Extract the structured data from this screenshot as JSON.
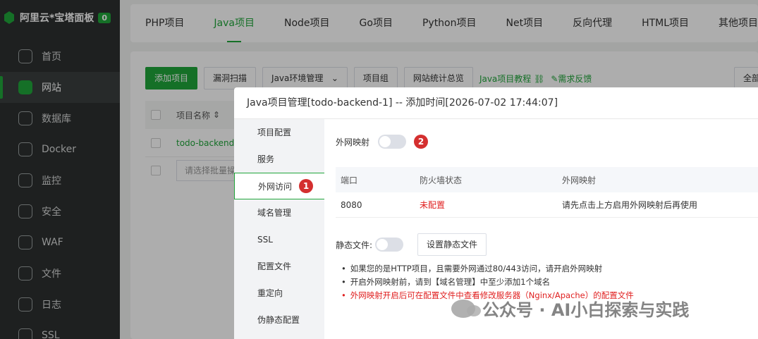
{
  "sidebar": {
    "brand": "阿里云*宝塔面板",
    "badge": "0",
    "items": [
      {
        "label": "首页",
        "icon": "home-icon"
      },
      {
        "label": "网站",
        "icon": "website-icon"
      },
      {
        "label": "数据库",
        "icon": "database-icon"
      },
      {
        "label": "Docker",
        "icon": "docker-icon"
      },
      {
        "label": "监控",
        "icon": "monitor-icon"
      },
      {
        "label": "安全",
        "icon": "shield-icon"
      },
      {
        "label": "WAF",
        "icon": "waf-icon"
      },
      {
        "label": "文件",
        "icon": "folder-icon"
      },
      {
        "label": "日志",
        "icon": "log-icon"
      },
      {
        "label": "SSL",
        "icon": "ssl-icon"
      }
    ]
  },
  "tabs": [
    "PHP项目",
    "Java项目",
    "Node项目",
    "Go项目",
    "Python项目",
    "Net项目",
    "反向代理",
    "HTML项目",
    "其他项目"
  ],
  "toolbar": {
    "add": "添加项目",
    "scan": "漏洞扫描",
    "env": "Java环境管理",
    "group": "项目组",
    "stats": "网站统计总览",
    "tutorial": "Java项目教程",
    "feedback": "需求反馈",
    "right": "全部"
  },
  "table": {
    "name_header": "项目名称",
    "row_name": "todo-backend",
    "batch_placeholder": "请选择批量操作"
  },
  "dialog": {
    "title": "Java项目管理[todo-backend-1] -- 添加时间[2026-07-02 17:44:07]",
    "nav": [
      "项目配置",
      "服务",
      "外网访问",
      "域名管理",
      "SSL",
      "配置文件",
      "重定向",
      "伪静态配置"
    ],
    "marker1": "1",
    "marker2": "2",
    "mapping_label": "外网映射",
    "columns": [
      "端口",
      "防火墙状态",
      "外网映射"
    ],
    "row": {
      "port": "8080",
      "firewall": "未配置",
      "mapping": "请先点击上方启用外网映射后再使用"
    },
    "static_label": "静态文件:",
    "static_button": "设置静态文件",
    "tips": [
      "如果您的是HTTP项目，且需要外网通过80/443访问，请开启外网映射",
      "开启外网映射前，请到【域名管理】中至少添加1个域名",
      "外网映射开启后可在配置文件中查看修改服务器（Nginx/Apache）的配置文件"
    ]
  },
  "watermark": "公众号 · AI小白探索与实践",
  "colors": {
    "accent": "#20a53a",
    "danger": "#e02020",
    "sidebar": "#2d3030"
  }
}
